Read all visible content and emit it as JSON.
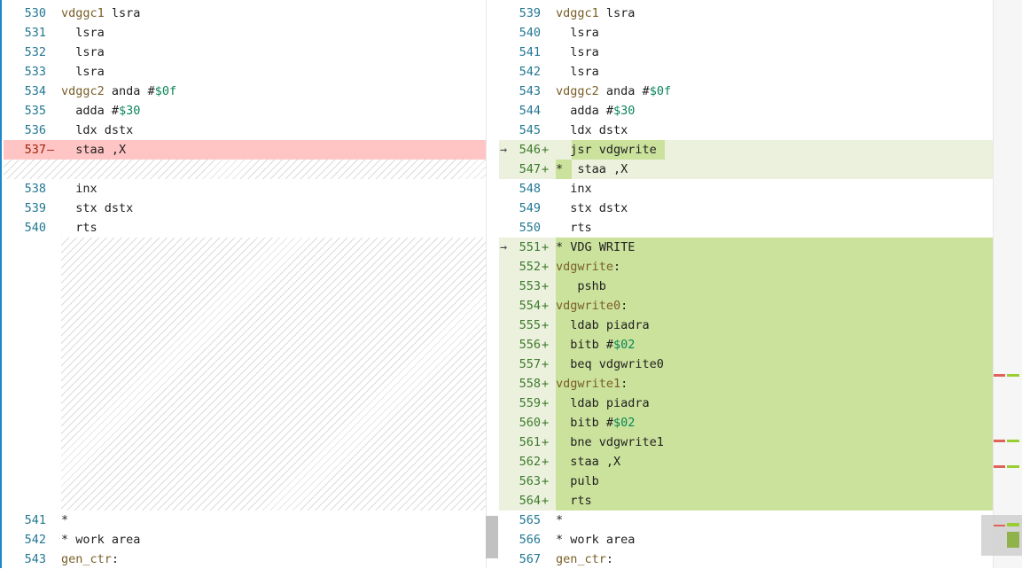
{
  "left": {
    "rows": [
      {
        "n": "530",
        "code": [
          {
            "t": "vdggc1",
            "c": "kw"
          },
          {
            "t": " lsra"
          }
        ]
      },
      {
        "n": "531",
        "code": [
          {
            "t": "  lsra"
          }
        ]
      },
      {
        "n": "532",
        "code": [
          {
            "t": "  lsra"
          }
        ]
      },
      {
        "n": "533",
        "code": [
          {
            "t": "  lsra"
          }
        ]
      },
      {
        "n": "534",
        "code": [
          {
            "t": "vdggc2",
            "c": "kw"
          },
          {
            "t": " anda #"
          },
          {
            "t": "$0f",
            "c": "hex"
          }
        ]
      },
      {
        "n": "535",
        "code": [
          {
            "t": "  adda #"
          },
          {
            "t": "$30",
            "c": "hex"
          }
        ]
      },
      {
        "n": "536",
        "code": [
          {
            "t": "  ldx dstx"
          }
        ]
      },
      {
        "n": "537",
        "sign": "—",
        "type": "del",
        "code": [
          {
            "t": "  staa ,X"
          }
        ]
      },
      {
        "n": "538",
        "code": [
          {
            "t": "  inx"
          }
        ]
      },
      {
        "n": "539",
        "code": [
          {
            "t": "  stx dstx"
          }
        ]
      },
      {
        "n": "540",
        "code": [
          {
            "t": "  rts"
          }
        ]
      },
      {
        "n": "541",
        "code": [
          {
            "t": "*"
          }
        ]
      },
      {
        "n": "542",
        "code": [
          {
            "t": "* work area"
          }
        ]
      },
      {
        "n": "543",
        "code": [
          {
            "t": "gen_ctr",
            "c": "kw"
          },
          {
            "t": ":"
          }
        ]
      }
    ]
  },
  "right": {
    "rows": [
      {
        "n": "539",
        "code": [
          {
            "t": "vdggc1",
            "c": "kw"
          },
          {
            "t": " lsra"
          }
        ]
      },
      {
        "n": "540",
        "code": [
          {
            "t": "  lsra"
          }
        ]
      },
      {
        "n": "541",
        "code": [
          {
            "t": "  lsra"
          }
        ]
      },
      {
        "n": "542",
        "code": [
          {
            "t": "  lsra"
          }
        ]
      },
      {
        "n": "543",
        "code": [
          {
            "t": "vdggc2",
            "c": "kw"
          },
          {
            "t": " anda #"
          },
          {
            "t": "$0f",
            "c": "hex"
          }
        ]
      },
      {
        "n": "544",
        "code": [
          {
            "t": "  adda #"
          },
          {
            "t": "$30",
            "c": "hex"
          }
        ]
      },
      {
        "n": "545",
        "code": [
          {
            "t": "  ldx dstx"
          }
        ]
      },
      {
        "n": "546",
        "sign": "+",
        "type": "add",
        "arrow": "→",
        "code": [
          {
            "t": "  jsr vdgwrite"
          }
        ]
      },
      {
        "n": "547",
        "sign": "+",
        "type": "add",
        "code": [
          {
            "t": "*  staa ,X"
          }
        ]
      },
      {
        "n": "548",
        "code": [
          {
            "t": "  inx"
          }
        ]
      },
      {
        "n": "549",
        "code": [
          {
            "t": "  stx dstx"
          }
        ]
      },
      {
        "n": "550",
        "code": [
          {
            "t": "  rts"
          }
        ]
      },
      {
        "n": "551",
        "sign": "+",
        "type": "add",
        "arrow": "→",
        "code": [
          {
            "t": "* VDG WRITE"
          }
        ]
      },
      {
        "n": "552",
        "sign": "+",
        "type": "add",
        "code": [
          {
            "t": "vdgwrite",
            "c": "kw"
          },
          {
            "t": ":"
          }
        ]
      },
      {
        "n": "553",
        "sign": "+",
        "type": "add",
        "code": [
          {
            "t": "   pshb"
          }
        ]
      },
      {
        "n": "554",
        "sign": "+",
        "type": "add",
        "code": [
          {
            "t": "vdgwrite0",
            "c": "kw"
          },
          {
            "t": ":"
          }
        ]
      },
      {
        "n": "555",
        "sign": "+",
        "type": "add",
        "code": [
          {
            "t": "  ldab piadra"
          }
        ]
      },
      {
        "n": "556",
        "sign": "+",
        "type": "add",
        "code": [
          {
            "t": "  bitb #"
          },
          {
            "t": "$02",
            "c": "hex"
          }
        ]
      },
      {
        "n": "557",
        "sign": "+",
        "type": "add",
        "code": [
          {
            "t": "  beq vdgwrite0"
          }
        ]
      },
      {
        "n": "558",
        "sign": "+",
        "type": "add",
        "code": [
          {
            "t": "vdgwrite1",
            "c": "kw"
          },
          {
            "t": ":"
          }
        ]
      },
      {
        "n": "559",
        "sign": "+",
        "type": "add",
        "code": [
          {
            "t": "  ldab piadra"
          }
        ]
      },
      {
        "n": "560",
        "sign": "+",
        "type": "add",
        "code": [
          {
            "t": "  bitb #"
          },
          {
            "t": "$02",
            "c": "hex"
          }
        ]
      },
      {
        "n": "561",
        "sign": "+",
        "type": "add",
        "code": [
          {
            "t": "  bne vdgwrite1"
          }
        ]
      },
      {
        "n": "562",
        "sign": "+",
        "type": "add",
        "code": [
          {
            "t": "  staa ,X"
          }
        ]
      },
      {
        "n": "563",
        "sign": "+",
        "type": "add",
        "code": [
          {
            "t": "  pulb"
          }
        ]
      },
      {
        "n": "564",
        "sign": "+",
        "type": "add",
        "code": [
          {
            "t": "  rts"
          }
        ]
      },
      {
        "n": "565",
        "code": [
          {
            "t": "*"
          }
        ]
      },
      {
        "n": "566",
        "code": [
          {
            "t": "* work area"
          }
        ]
      },
      {
        "n": "567",
        "code": [
          {
            "t": "gen_ctr",
            "c": "kw"
          },
          {
            "t": ":"
          }
        ]
      }
    ]
  },
  "colors": {
    "deleted": "#ffc4c4",
    "inserted": "#cbe29c",
    "inserted_light": "#ebf1dd",
    "line_number": "#237893"
  }
}
